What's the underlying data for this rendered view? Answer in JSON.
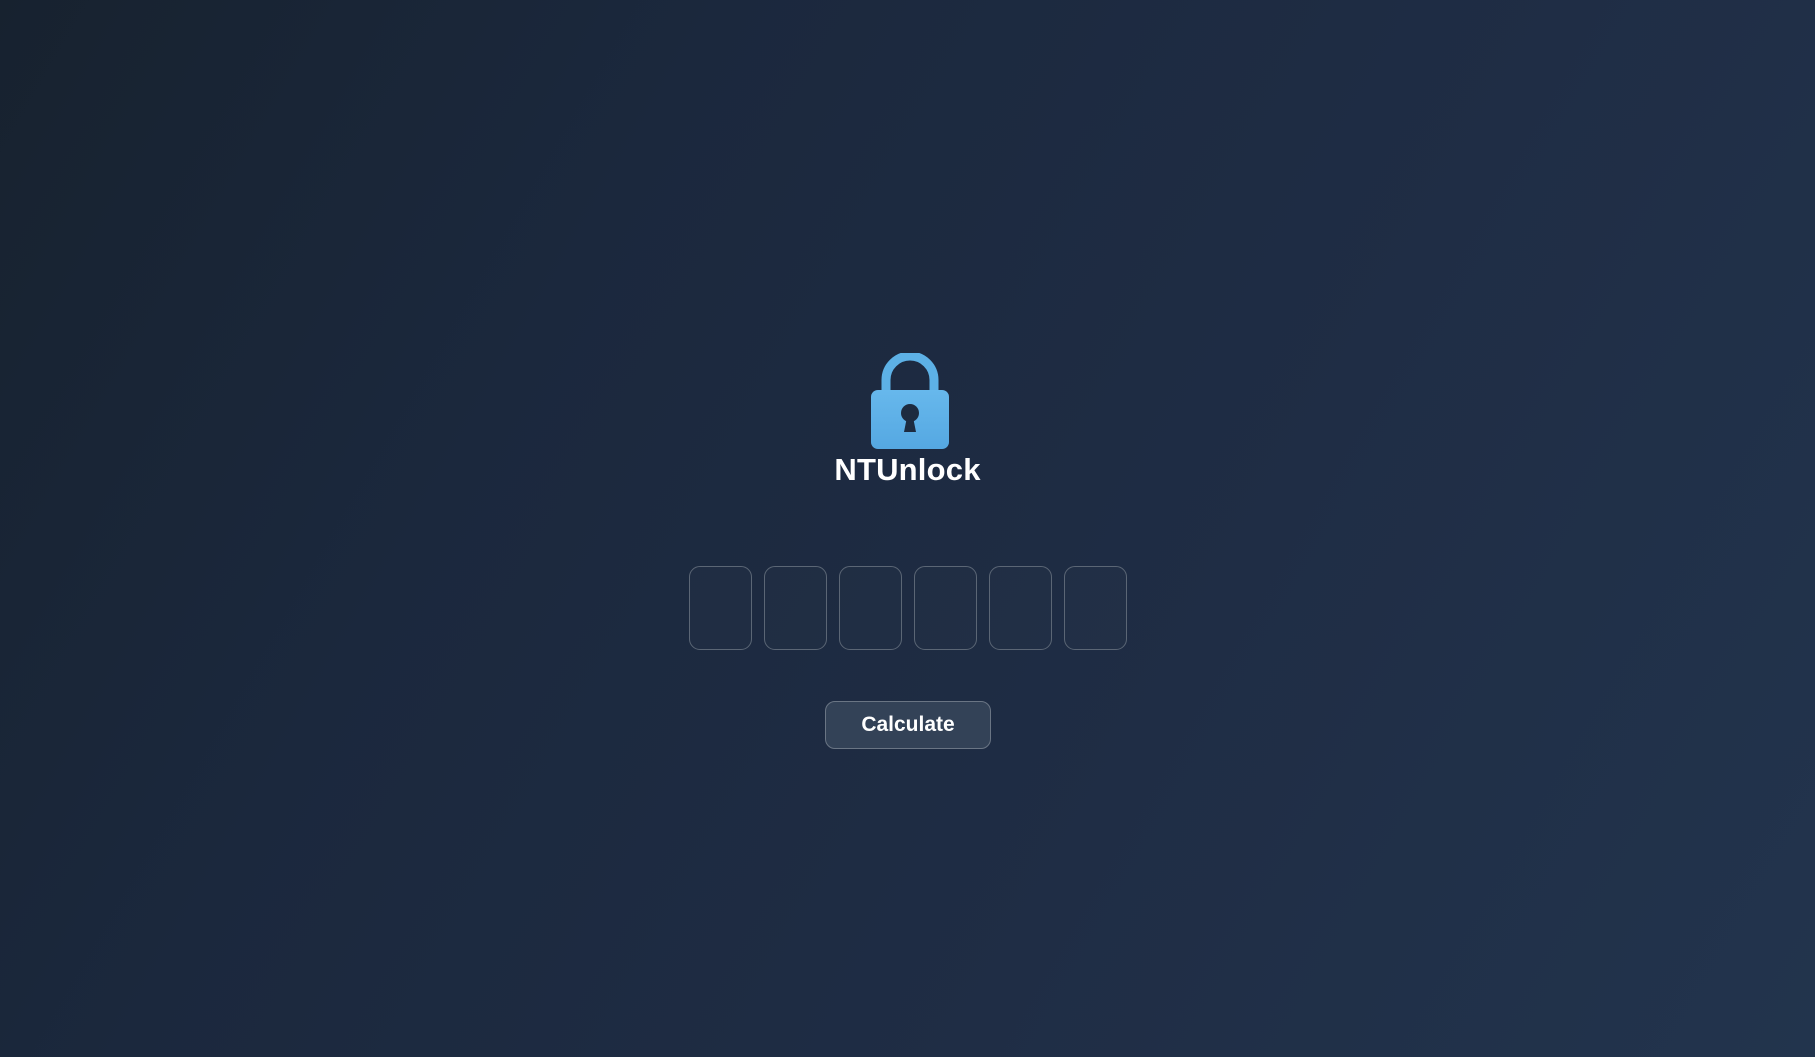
{
  "app": {
    "title": "NTUnlock",
    "logo_icon": "padlock-icon",
    "accent_color": "#5db1e6"
  },
  "code_inputs": {
    "count": 6,
    "values": [
      "",
      "",
      "",
      "",
      "",
      ""
    ]
  },
  "actions": {
    "calculate_label": "Calculate"
  }
}
